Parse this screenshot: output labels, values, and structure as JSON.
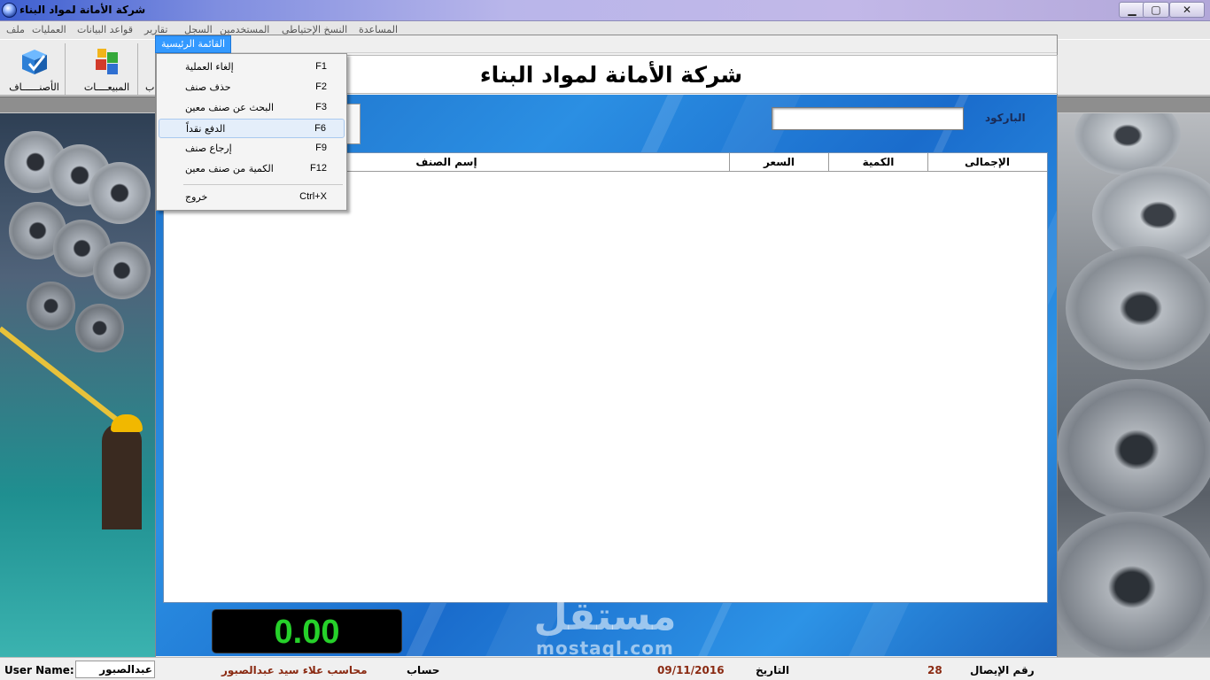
{
  "window": {
    "title": "شركة الأمانة لمواد البناء",
    "controls": {
      "minimize": "▁",
      "maximize": "▢",
      "close": "✕"
    }
  },
  "menubar": {
    "items": [
      "ملف",
      "العمليات",
      "قواعد البيانات",
      "تقارير",
      "السجل",
      "المستخدمين",
      "النسخ الإحتياطي",
      "المساعدة"
    ]
  },
  "toolbar": {
    "items_label": "الأصنــــــاف",
    "sales_label": "المبيعــــات",
    "partial_label": "ب"
  },
  "child_menu": {
    "header": "القائمة الرئيسية",
    "items": [
      {
        "label": "إلغاء العملية",
        "shortcut": "F1"
      },
      {
        "label": "حذف صنف",
        "shortcut": "F2"
      },
      {
        "label": "البحث عن صنف معين",
        "shortcut": "F3"
      },
      {
        "label": "الدفع نقداً",
        "shortcut": "F6"
      },
      {
        "label": "إرجاع صنف",
        "shortcut": "F9"
      },
      {
        "label": "الكمية من صنف معين",
        "shortcut": "F12"
      },
      {
        "label": "خروج",
        "shortcut": "Ctrl+X"
      }
    ]
  },
  "sales_form": {
    "company_name": "شركة الأمانة لمواد البناء",
    "barcode_label": "الباركود",
    "barcode_value": "",
    "columns": [
      "الإجمالى",
      "الكمية",
      "السعر",
      "إسم الصنف"
    ],
    "total": "0.00"
  },
  "status": {
    "user_name_label": "User Name:",
    "user_name_value": "عبدالصبور",
    "accountant_name": "محاسب علاء سيد عبدالصبور",
    "account_label": "حساب",
    "date_value": "09/11/2016",
    "date_label": "التاريخ",
    "receipt_value": "28",
    "receipt_label": "رقم الإيصال"
  },
  "watermark": {
    "arabic": "مستقل",
    "latin": "mostaql.com"
  },
  "colors": {
    "accent_blue": "#3399ff",
    "total_green": "#26d12a",
    "panel_blue": "#2b8fe3"
  }
}
